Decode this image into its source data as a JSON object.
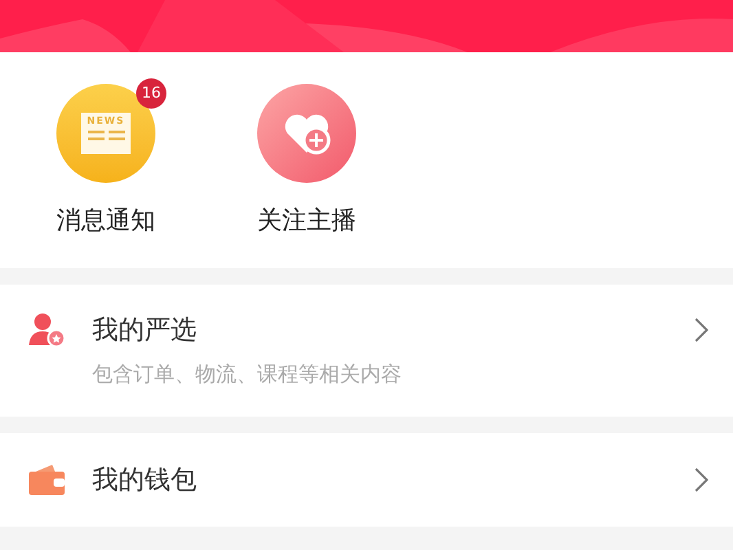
{
  "shortcuts": [
    {
      "kind": "news",
      "icon_text": "NEWS",
      "label": "消息通知",
      "badge": "16"
    },
    {
      "kind": "follow",
      "label": "关注主播"
    }
  ],
  "menu": [
    {
      "kind": "selection",
      "title": "我的严选",
      "subtitle": "包含订单、物流、课程等相关内容"
    },
    {
      "kind": "wallet",
      "title": "我的钱包"
    }
  ]
}
